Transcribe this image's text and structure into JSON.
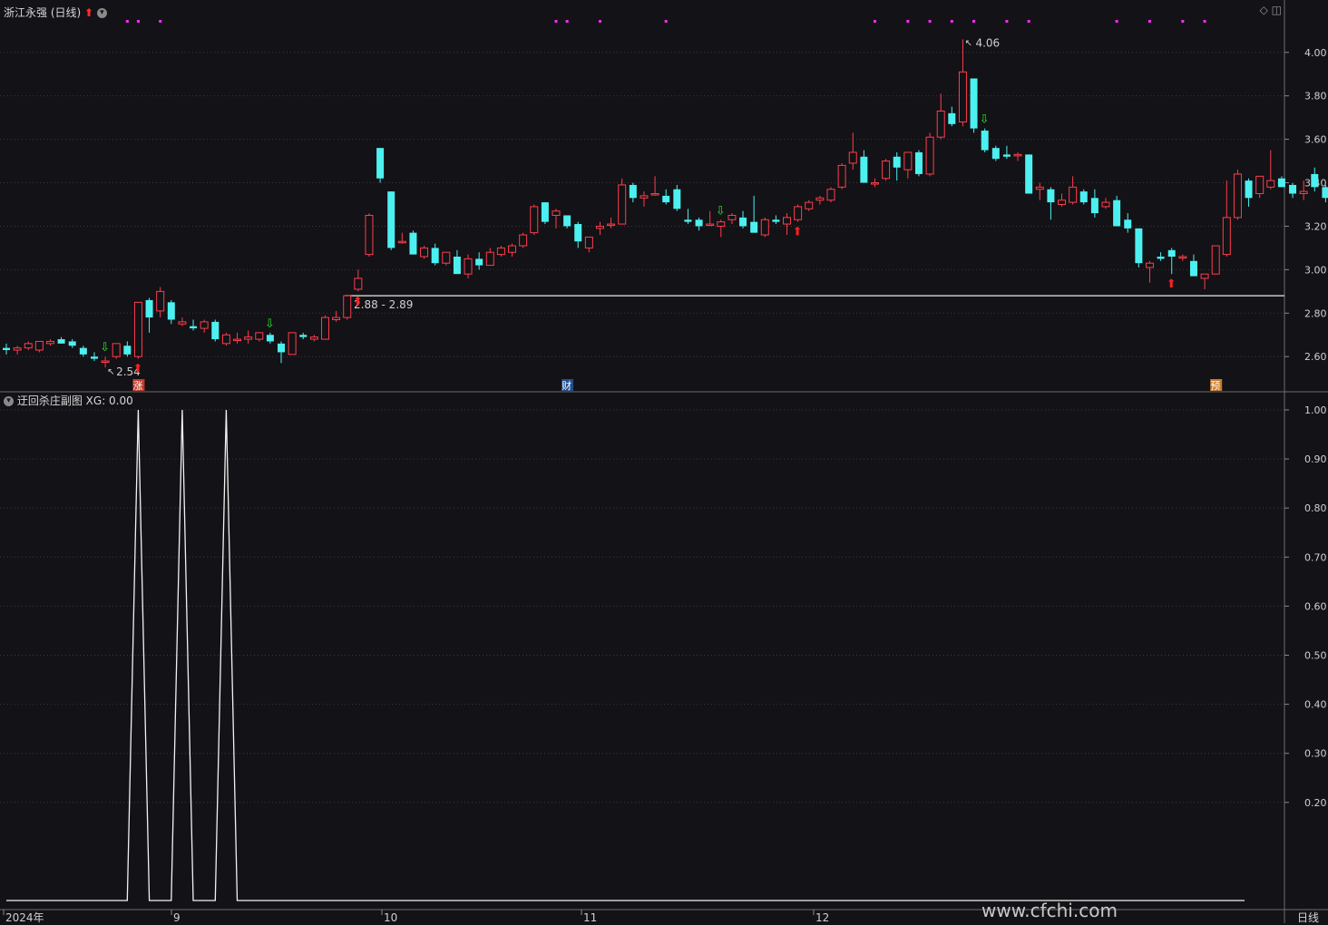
{
  "header": {
    "stock_title": "浙江永强 (日线)",
    "colors": {
      "up": "#ff3d4d",
      "down": "#4df0f0",
      "bg": "#131216"
    }
  },
  "price_annotations": {
    "high_label": "4.06",
    "low_label": "2.54",
    "range_label": "2.88 - 2.89"
  },
  "event_badges": [
    {
      "text": "涨",
      "color": "#c0392b"
    },
    {
      "text": "财",
      "color": "#1f4e8c"
    },
    {
      "text": "预",
      "color": "#c87a2a"
    }
  ],
  "sub_panel": {
    "title": "迂回杀庄副图",
    "xg_readout": "XG: 0.00"
  },
  "x_axis": {
    "labels": [
      "2024年",
      "9",
      "10",
      "11",
      "12"
    ],
    "period_label": "日线"
  },
  "watermark": "www.cfchi.com",
  "chart_data": [
    {
      "type": "candlestick",
      "title": "浙江永强 (日线)",
      "y_ticks": [
        "4.00",
        "3.80",
        "3.60",
        "3.40",
        "3.20",
        "3.00",
        "2.80",
        "2.60"
      ],
      "ylim": [
        2.53,
        4.12
      ],
      "reference_line": 2.88,
      "ohlc": [
        [
          2.64,
          2.66,
          2.61,
          2.63
        ],
        [
          2.63,
          2.65,
          2.61,
          2.64
        ],
        [
          2.64,
          2.67,
          2.63,
          2.66
        ],
        [
          2.63,
          2.67,
          2.62,
          2.67
        ],
        [
          2.66,
          2.68,
          2.65,
          2.67
        ],
        [
          2.68,
          2.69,
          2.66,
          2.66
        ],
        [
          2.67,
          2.68,
          2.64,
          2.65
        ],
        [
          2.64,
          2.65,
          2.6,
          2.61
        ],
        [
          2.6,
          2.62,
          2.58,
          2.59
        ],
        [
          2.58,
          2.6,
          2.55,
          2.58
        ],
        [
          2.6,
          2.66,
          2.59,
          2.66
        ],
        [
          2.65,
          2.67,
          2.6,
          2.61
        ],
        [
          2.6,
          2.85,
          2.59,
          2.85
        ],
        [
          2.86,
          2.87,
          2.71,
          2.78
        ],
        [
          2.81,
          2.92,
          2.78,
          2.9
        ],
        [
          2.85,
          2.86,
          2.75,
          2.77
        ],
        [
          2.75,
          2.78,
          2.74,
          2.76
        ],
        [
          2.74,
          2.77,
          2.72,
          2.73
        ],
        [
          2.73,
          2.77,
          2.71,
          2.76
        ],
        [
          2.76,
          2.77,
          2.67,
          2.68
        ],
        [
          2.66,
          2.71,
          2.65,
          2.7
        ],
        [
          2.68,
          2.71,
          2.66,
          2.68
        ],
        [
          2.68,
          2.72,
          2.66,
          2.69
        ],
        [
          2.68,
          2.71,
          2.67,
          2.71
        ],
        [
          2.7,
          2.71,
          2.66,
          2.67
        ],
        [
          2.66,
          2.67,
          2.57,
          2.62
        ],
        [
          2.61,
          2.71,
          2.61,
          2.71
        ],
        [
          2.7,
          2.71,
          2.68,
          2.69
        ],
        [
          2.68,
          2.7,
          2.67,
          2.69
        ],
        [
          2.68,
          2.79,
          2.68,
          2.78
        ],
        [
          2.77,
          2.81,
          2.76,
          2.78
        ],
        [
          2.78,
          2.87,
          2.77,
          2.88
        ],
        [
          2.91,
          3.0,
          2.9,
          2.96
        ],
        [
          3.07,
          3.26,
          3.06,
          3.25
        ],
        [
          3.56,
          3.56,
          3.4,
          3.42
        ],
        [
          3.36,
          3.36,
          3.09,
          3.1
        ],
        [
          3.13,
          3.17,
          3.12,
          3.13
        ],
        [
          3.17,
          3.18,
          3.07,
          3.07
        ],
        [
          3.06,
          3.11,
          3.05,
          3.1
        ],
        [
          3.1,
          3.12,
          3.02,
          3.03
        ],
        [
          3.03,
          3.08,
          3.02,
          3.08
        ],
        [
          3.06,
          3.09,
          2.99,
          2.98
        ],
        [
          2.98,
          3.07,
          2.96,
          3.05
        ],
        [
          3.05,
          3.08,
          3.0,
          3.02
        ],
        [
          3.02,
          3.1,
          3.02,
          3.08
        ],
        [
          3.07,
          3.11,
          3.06,
          3.1
        ],
        [
          3.08,
          3.12,
          3.06,
          3.11
        ],
        [
          3.11,
          3.17,
          3.1,
          3.16
        ],
        [
          3.17,
          3.3,
          3.16,
          3.29
        ],
        [
          3.31,
          3.31,
          3.21,
          3.22
        ],
        [
          3.25,
          3.28,
          3.19,
          3.27
        ],
        [
          3.25,
          3.25,
          3.19,
          3.2
        ],
        [
          3.21,
          3.22,
          3.1,
          3.13
        ],
        [
          3.1,
          3.15,
          3.08,
          3.15
        ],
        [
          3.19,
          3.22,
          3.16,
          3.2
        ],
        [
          3.21,
          3.24,
          3.19,
          3.21
        ],
        [
          3.21,
          3.42,
          3.21,
          3.39
        ],
        [
          3.39,
          3.4,
          3.31,
          3.33
        ],
        [
          3.33,
          3.36,
          3.29,
          3.34
        ],
        [
          3.35,
          3.43,
          3.34,
          3.35
        ],
        [
          3.34,
          3.37,
          3.3,
          3.31
        ],
        [
          3.37,
          3.39,
          3.27,
          3.28
        ],
        [
          3.23,
          3.28,
          3.21,
          3.22
        ],
        [
          3.23,
          3.24,
          3.18,
          3.2
        ],
        [
          3.21,
          3.27,
          3.2,
          3.21
        ],
        [
          3.2,
          3.23,
          3.15,
          3.22
        ],
        [
          3.23,
          3.26,
          3.21,
          3.25
        ],
        [
          3.24,
          3.27,
          3.19,
          3.2
        ],
        [
          3.22,
          3.34,
          3.17,
          3.17
        ],
        [
          3.16,
          3.24,
          3.15,
          3.23
        ],
        [
          3.23,
          3.25,
          3.21,
          3.22
        ],
        [
          3.21,
          3.26,
          3.16,
          3.24
        ],
        [
          3.23,
          3.3,
          3.22,
          3.29
        ],
        [
          3.28,
          3.32,
          3.27,
          3.31
        ],
        [
          3.32,
          3.34,
          3.3,
          3.33
        ],
        [
          3.32,
          3.38,
          3.31,
          3.37
        ],
        [
          3.38,
          3.49,
          3.37,
          3.48
        ],
        [
          3.49,
          3.63,
          3.46,
          3.54
        ],
        [
          3.52,
          3.55,
          3.4,
          3.4
        ],
        [
          3.4,
          3.42,
          3.38,
          3.4
        ],
        [
          3.42,
          3.51,
          3.41,
          3.5
        ],
        [
          3.52,
          3.54,
          3.41,
          3.47
        ],
        [
          3.46,
          3.54,
          3.42,
          3.54
        ],
        [
          3.54,
          3.55,
          3.43,
          3.44
        ],
        [
          3.44,
          3.63,
          3.43,
          3.61
        ],
        [
          3.61,
          3.81,
          3.6,
          3.73
        ],
        [
          3.72,
          3.75,
          3.66,
          3.67
        ],
        [
          3.68,
          4.06,
          3.66,
          3.91
        ],
        [
          3.88,
          3.88,
          3.63,
          3.65
        ],
        [
          3.64,
          3.65,
          3.54,
          3.55
        ],
        [
          3.56,
          3.57,
          3.5,
          3.51
        ],
        [
          3.53,
          3.57,
          3.51,
          3.52
        ],
        [
          3.53,
          3.54,
          3.5,
          3.53
        ],
        [
          3.53,
          3.53,
          3.35,
          3.35
        ],
        [
          3.37,
          3.4,
          3.32,
          3.38
        ],
        [
          3.37,
          3.38,
          3.23,
          3.31
        ],
        [
          3.3,
          3.35,
          3.29,
          3.32
        ],
        [
          3.31,
          3.43,
          3.3,
          3.38
        ],
        [
          3.36,
          3.37,
          3.3,
          3.31
        ],
        [
          3.33,
          3.37,
          3.24,
          3.26
        ],
        [
          3.29,
          3.33,
          3.28,
          3.31
        ],
        [
          3.32,
          3.34,
          3.2,
          3.2
        ],
        [
          3.23,
          3.26,
          3.17,
          3.19
        ],
        [
          3.19,
          3.19,
          3.01,
          3.03
        ],
        [
          3.01,
          3.04,
          2.94,
          3.03
        ],
        [
          3.06,
          3.08,
          3.04,
          3.05
        ],
        [
          3.09,
          3.1,
          2.98,
          3.06
        ],
        [
          3.06,
          3.07,
          3.04,
          3.06
        ],
        [
          3.04,
          3.07,
          2.99,
          2.97
        ],
        [
          2.96,
          2.97,
          2.91,
          2.98
        ],
        [
          2.98,
          3.11,
          2.98,
          3.11
        ],
        [
          3.07,
          3.41,
          3.06,
          3.24
        ],
        [
          3.24,
          3.46,
          3.23,
          3.44
        ],
        [
          3.41,
          3.42,
          3.29,
          3.33
        ],
        [
          3.35,
          3.43,
          3.33,
          3.43
        ],
        [
          3.38,
          3.55,
          3.37,
          3.41
        ],
        [
          3.42,
          3.43,
          3.38,
          3.38
        ],
        [
          3.39,
          3.4,
          3.33,
          3.35
        ],
        [
          3.35,
          3.41,
          3.32,
          3.36
        ],
        [
          3.44,
          3.47,
          3.36,
          3.38
        ],
        [
          3.38,
          3.39,
          3.31,
          3.33
        ],
        [
          3.38,
          3.51,
          3.39,
          3.4
        ]
      ],
      "down_arrow_signals_at": [
        9,
        24,
        65,
        89
      ],
      "up_arrow_signals_at": [
        12,
        32,
        72,
        106
      ],
      "top_markers_at": [
        11,
        12,
        14,
        50,
        51,
        54,
        60,
        79,
        82,
        84,
        86,
        88,
        91,
        93,
        101,
        104,
        107,
        109
      ]
    },
    {
      "type": "line",
      "title": "迂回杀庄副图",
      "series": [
        {
          "name": "XG",
          "spikes_at": [
            12,
            16,
            20
          ],
          "value_on_spike": 1.0,
          "value_elsewhere": 0.0
        }
      ],
      "y_ticks": [
        "1.00",
        "0.90",
        "0.80",
        "0.70",
        "0.60",
        "0.50",
        "0.40",
        "0.30",
        "0.20"
      ],
      "ylim": [
        0.0,
        1.0
      ]
    }
  ]
}
